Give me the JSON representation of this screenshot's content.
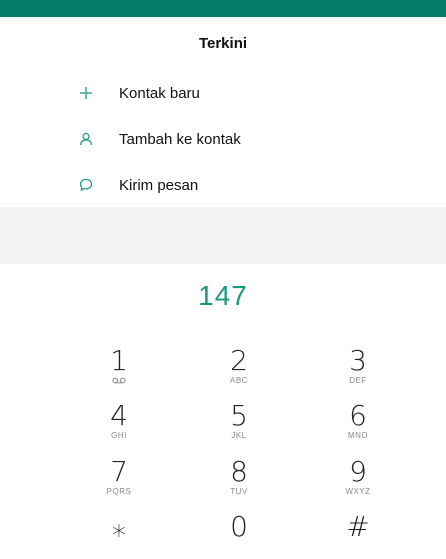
{
  "header": {
    "title": "Terkini"
  },
  "menu": [
    {
      "icon": "plus-icon",
      "label": "Kontak baru"
    },
    {
      "icon": "person-icon",
      "label": "Tambah ke kontak"
    },
    {
      "icon": "chat-bubble-icon",
      "label": "Kirim pesan"
    }
  ],
  "dialer": {
    "number": "147",
    "keys": [
      {
        "digit": "1",
        "letters": "",
        "icon": "voicemail-icon"
      },
      {
        "digit": "2",
        "letters": "ABC"
      },
      {
        "digit": "3",
        "letters": "DEF"
      },
      {
        "digit": "4",
        "letters": "GHI"
      },
      {
        "digit": "5",
        "letters": "JKL"
      },
      {
        "digit": "6",
        "letters": "MNO"
      },
      {
        "digit": "7",
        "letters": "PQRS"
      },
      {
        "digit": "8",
        "letters": "TUV"
      },
      {
        "digit": "9",
        "letters": "WXYZ"
      },
      {
        "digit": "⁎",
        "letters": ""
      },
      {
        "digit": "0",
        "letters": ""
      },
      {
        "digit": "#",
        "letters": ""
      }
    ]
  },
  "colors": {
    "status_bar": "#047b68",
    "accent": "#1a9a7c",
    "band": "#f4f4f4"
  }
}
